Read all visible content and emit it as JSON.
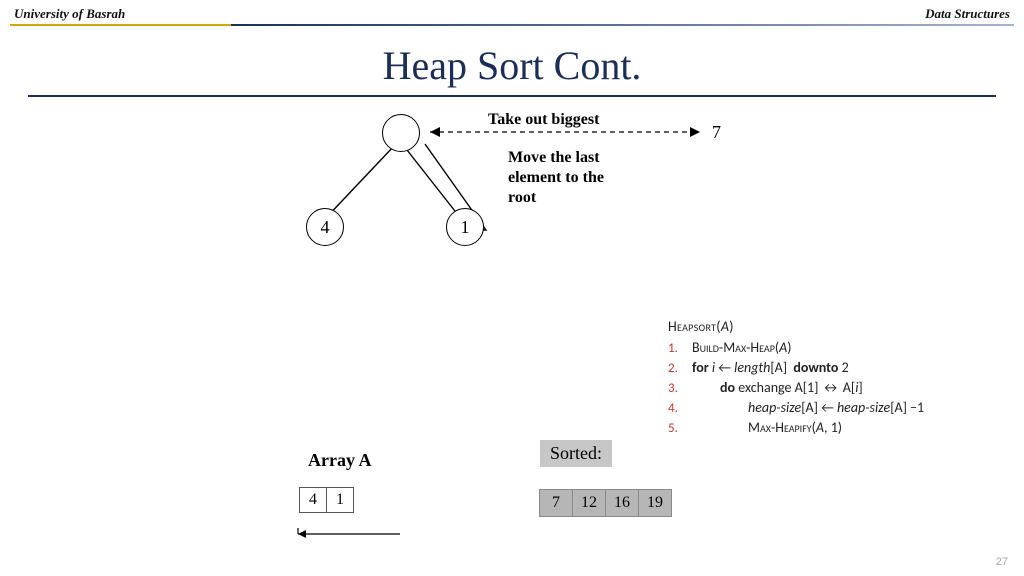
{
  "header": {
    "left": "University of Basrah",
    "right": "Data Structures"
  },
  "title": "Heap Sort Cont.",
  "diagram": {
    "root": "",
    "left_child": "4",
    "right_child": "1",
    "annot_top": "Take out biggest",
    "annot_mid_l1": "Move the last",
    "annot_mid_l2": "element to the",
    "annot_mid_l3": "root",
    "extracted_value": "7"
  },
  "algorithm": {
    "title_fn": "Heapsort",
    "title_arg": "A",
    "lines": [
      {
        "n": "1.",
        "indent": 0,
        "html": "<span class='sc'>Build-Max-Heap</span>(<span class='it'>A</span>)"
      },
      {
        "n": "2.",
        "indent": 0,
        "html": "<b>for</b> <span class='it'>i</span> ← <span class='it'>length</span>[A]&nbsp; <b>downto</b> 2"
      },
      {
        "n": "3.",
        "indent": 1,
        "html": "<b>do</b> exchange A[1] ↔ A[<span class='it'>i</span>]"
      },
      {
        "n": "4.",
        "indent": 2,
        "html": "<span class='it'>heap-size</span>[A] ← <span class='it'>heap-size</span>[A] −1"
      },
      {
        "n": "5.",
        "indent": 2,
        "html": "<span class='sc'>Max-Heapify</span>(<span class='it'>A</span>, 1)"
      }
    ]
  },
  "array": {
    "label": "Array A",
    "cells": [
      "4",
      "1"
    ]
  },
  "sorted": {
    "label": "Sorted:",
    "cells": [
      "7",
      "12",
      "16",
      "19"
    ]
  },
  "page_number": "27"
}
